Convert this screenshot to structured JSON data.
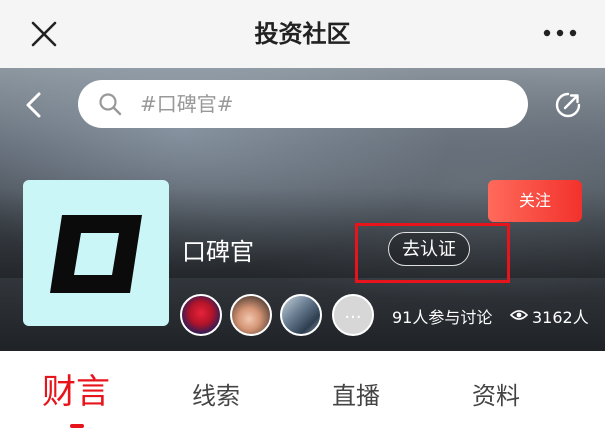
{
  "header": {
    "title": "投资社区",
    "close_icon": "close-icon",
    "more_icon": "more-icon"
  },
  "search": {
    "text": "#口碑官#"
  },
  "topic": {
    "name": "口碑官",
    "logo_text": "口",
    "verify_label": "去认证",
    "follow_label": "关注",
    "avatar_more": "...",
    "discussion": "91人参与讨论",
    "views": "3162人"
  },
  "tabs": [
    {
      "label": "财言",
      "active": true
    },
    {
      "label": "线索",
      "active": false
    },
    {
      "label": "直播",
      "active": false
    },
    {
      "label": "资料",
      "active": false
    }
  ],
  "colors": {
    "accent": "#e8141b",
    "follow_button": "#f2322c",
    "logo_background": "#cbf6f7"
  }
}
